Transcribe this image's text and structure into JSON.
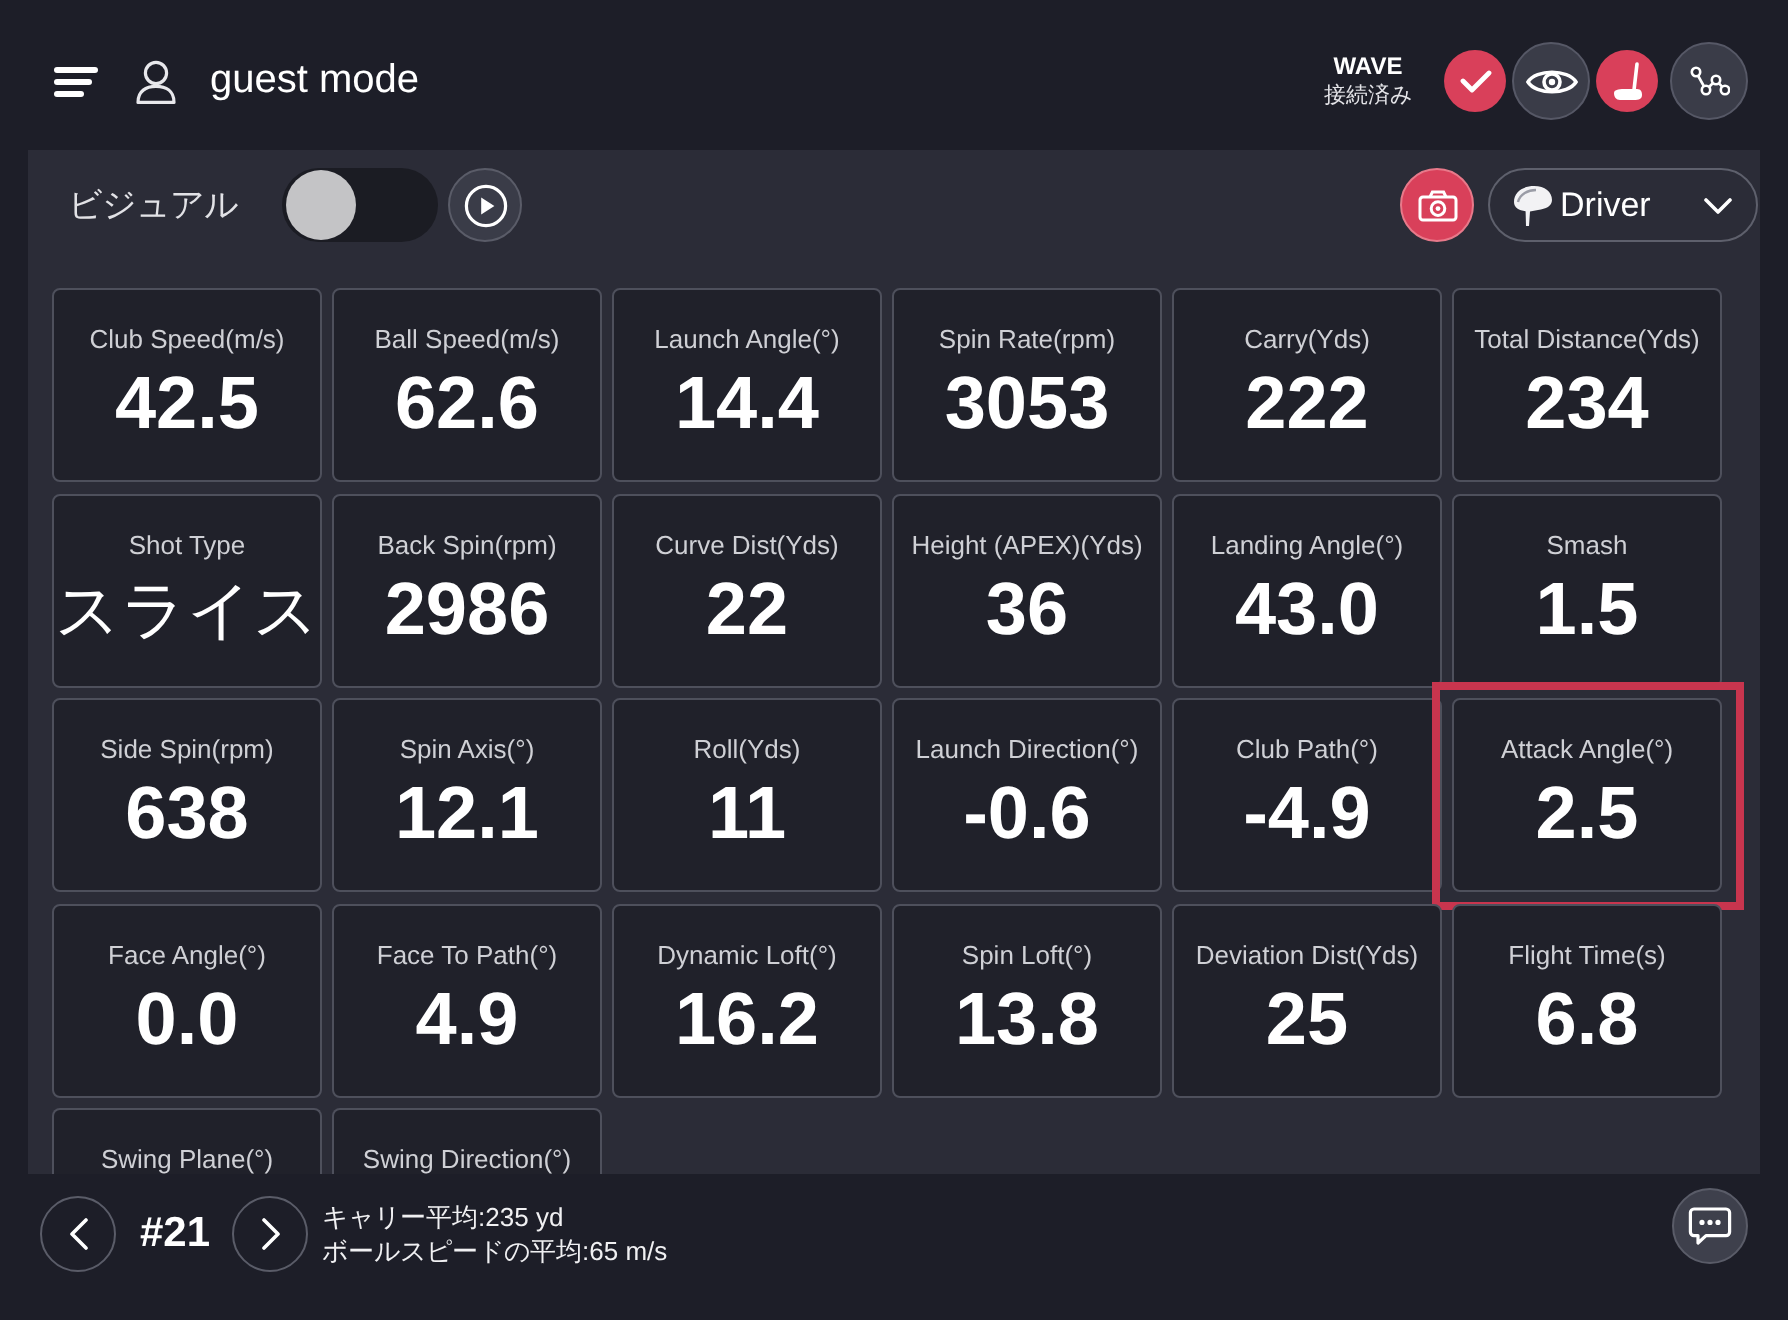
{
  "header": {
    "user_label": "guest mode",
    "device_name": "WAVE",
    "connection_status": "接続済み",
    "buttons": [
      {
        "kind": "check",
        "active": true
      },
      {
        "kind": "eye",
        "active": false
      },
      {
        "kind": "putter",
        "active": true
      },
      {
        "kind": "network",
        "active": false
      }
    ]
  },
  "toolbar": {
    "visual_label": "ビジュアル",
    "visual_toggle": {
      "on": false
    },
    "club_select": {
      "value": "Driver"
    }
  },
  "metrics": [
    {
      "label": "Club Speed(m/s)",
      "value": "42.5",
      "kind": "number",
      "highlighted": false
    },
    {
      "label": "Ball Speed(m/s)",
      "value": "62.6",
      "kind": "number",
      "highlighted": false
    },
    {
      "label": "Launch Angle(°)",
      "value": "14.4",
      "kind": "number",
      "highlighted": false
    },
    {
      "label": "Spin Rate(rpm)",
      "value": "3053",
      "kind": "number",
      "highlighted": false
    },
    {
      "label": "Carry(Yds)",
      "value": "222",
      "kind": "number",
      "highlighted": false
    },
    {
      "label": "Total Distance(Yds)",
      "value": "234",
      "kind": "number",
      "highlighted": false
    },
    {
      "label": "Shot Type",
      "value": "スライス",
      "kind": "text",
      "highlighted": false
    },
    {
      "label": "Back Spin(rpm)",
      "value": "2986",
      "kind": "number",
      "highlighted": false
    },
    {
      "label": "Curve Dist(Yds)",
      "value": "22",
      "kind": "number",
      "highlighted": false
    },
    {
      "label": "Height (APEX)(Yds)",
      "value": "36",
      "kind": "number",
      "highlighted": false
    },
    {
      "label": "Landing Angle(°)",
      "value": "43.0",
      "kind": "number",
      "highlighted": false
    },
    {
      "label": "Smash",
      "value": "1.5",
      "kind": "number",
      "highlighted": false
    },
    {
      "label": "Side Spin(rpm)",
      "value": "638",
      "kind": "number",
      "highlighted": false
    },
    {
      "label": "Spin Axis(°)",
      "value": "12.1",
      "kind": "number",
      "highlighted": false
    },
    {
      "label": "Roll(Yds)",
      "value": "11",
      "kind": "number",
      "highlighted": false
    },
    {
      "label": "Launch Direction(°)",
      "value": "-0.6",
      "kind": "number",
      "highlighted": false
    },
    {
      "label": "Club Path(°)",
      "value": "-4.9",
      "kind": "number",
      "highlighted": false
    },
    {
      "label": "Attack Angle(°)",
      "value": "2.5",
      "kind": "number",
      "highlighted": true
    },
    {
      "label": "Face Angle(°)",
      "value": "0.0",
      "kind": "number",
      "highlighted": false
    },
    {
      "label": "Face To Path(°)",
      "value": "4.9",
      "kind": "number",
      "highlighted": false
    },
    {
      "label": "Dynamic Loft(°)",
      "value": "16.2",
      "kind": "number",
      "highlighted": false
    },
    {
      "label": "Spin Loft(°)",
      "value": "13.8",
      "kind": "number",
      "highlighted": false
    },
    {
      "label": "Deviation Dist(Yds)",
      "value": "25",
      "kind": "number",
      "highlighted": false
    },
    {
      "label": "Flight Time(s)",
      "value": "6.8",
      "kind": "number",
      "highlighted": false
    },
    {
      "label": "Swing Plane(°)",
      "highlighted": false
    },
    {
      "label": "Swing Direction(°)",
      "highlighted": false
    }
  ],
  "footer": {
    "shot_number": "#21",
    "summary": [
      "キャリー平均:235 yd",
      "ボールスピードの平均:65 m/s"
    ]
  }
}
